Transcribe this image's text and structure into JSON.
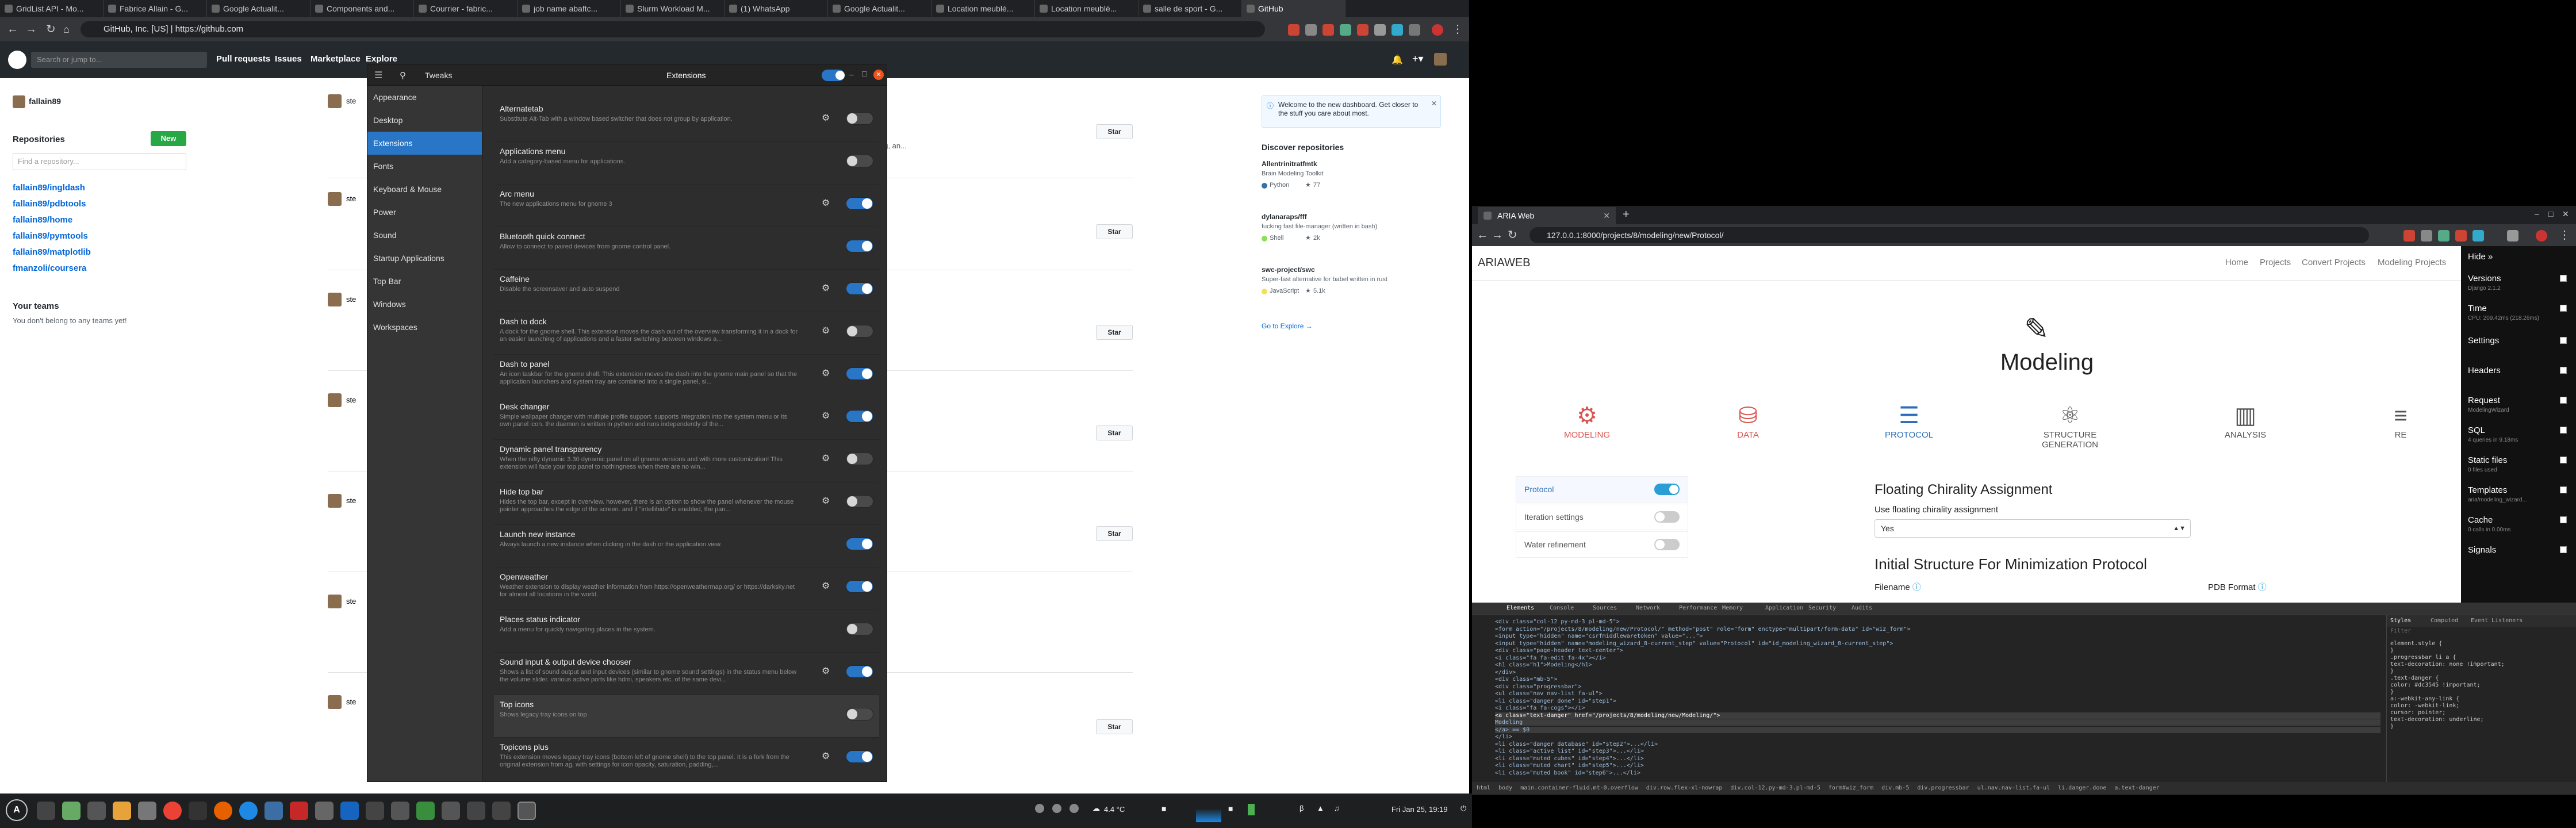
{
  "left_browser": {
    "tabs": [
      "GridList API - Mo...",
      "Fabrice Allain - G...",
      "Google Actualit...",
      "Components and...",
      "Courrier - fabric...",
      "job name abaftc...",
      "Slurm Workload M...",
      "(1) WhatsApp",
      "Google Actualit...",
      "Location meublé...",
      "Location meublé...",
      "salle de sport - G...",
      "GitHub"
    ],
    "url": "GitHub, Inc. [US]  |  https://github.com"
  },
  "github": {
    "search_placeholder": "Search or jump to...",
    "nav": [
      "Pull requests",
      "Issues",
      "Marketplace",
      "Explore"
    ],
    "user": "fallain89",
    "repositories_heading": "Repositories",
    "new_button": "New",
    "find_repo_placeholder": "Find a repository...",
    "repos": [
      "fallain89/ingldash",
      "fallain89/pdbtools",
      "fallain89/home",
      "fallain89/pymtools",
      "fallain89/matplotlib",
      "fmanzoli/coursera"
    ],
    "teams_heading": "Your teams",
    "teams_text": "You don't belong to any teams yet!",
    "feed_star": "Star",
    "feed_snippet": "eg, an...",
    "welcome_text": "Welcome to the new dashboard. Get closer to the stuff you care about most.",
    "discover_heading": "Discover repositories",
    "discover": [
      {
        "name": "Allentrinitratfmtk",
        "desc": "Brain Modeling Toolkit",
        "lang": "Python",
        "stars": "77"
      },
      {
        "name": "dylanaraps/fff",
        "desc": "fucking fast file-manager (written in bash)",
        "lang": "Shell",
        "stars": "2k"
      },
      {
        "name": "swc-project/swc",
        "desc": "Super-fast alternative for babel written in rust",
        "lang": "JavaScript",
        "stars": "5.1k"
      }
    ],
    "go_explore": "Go to Explore →"
  },
  "tweaks": {
    "app_name": "Tweaks",
    "section_title": "Extensions",
    "nav": [
      "Appearance",
      "Desktop",
      "Extensions",
      "Fonts",
      "Keyboard & Mouse",
      "Power",
      "Sound",
      "Startup Applications",
      "Top Bar",
      "Windows",
      "Workspaces"
    ],
    "extensions": [
      {
        "name": "Alternatetab",
        "desc": "Substitute Alt-Tab with a window based switcher that does not group by application.",
        "gear": true,
        "on": false
      },
      {
        "name": "Applications menu",
        "desc": "Add a category-based menu for applications.",
        "gear": false,
        "on": false
      },
      {
        "name": "Arc menu",
        "desc": "The new applications menu for gnome 3",
        "gear": true,
        "on": true
      },
      {
        "name": "Bluetooth quick connect",
        "desc": "Allow to connect to paired devices from gnome control panel.",
        "gear": false,
        "on": true
      },
      {
        "name": "Caffeine",
        "desc": "Disable the screensaver and auto suspend",
        "gear": true,
        "on": true
      },
      {
        "name": "Dash to dock",
        "desc": "A dock for the gnome shell. This extension moves the dash out of the overview transforming it in a dock for an easier launching of applications and a faster switching between windows a...",
        "gear": true,
        "on": false
      },
      {
        "name": "Dash to panel",
        "desc": "An icon taskbar for the gnome shell. This extension moves the dash into the gnome main panel so that the application launchers and system tray are combined into a single panel, si...",
        "gear": true,
        "on": true
      },
      {
        "name": "Desk changer",
        "desc": "Simple wallpaper changer with multiple profile support. supports integration into the system menu or its own panel icon. the daemon is written in python and runs independently of the...",
        "gear": true,
        "on": true
      },
      {
        "name": "Dynamic panel transparency",
        "desc": "When the nifty dynamic 3.30 dynamic panel on all gnome versions and with more customization! This extension will fade your top panel to nothingness when there are no win...",
        "gear": true,
        "on": false
      },
      {
        "name": "Hide top bar",
        "desc": "Hides the top bar, except in overview. however, there is an option to show the panel whenever the mouse pointer approaches the edge of the screen. and if \"intellihide\" is enabled, the pan...",
        "gear": true,
        "on": false
      },
      {
        "name": "Launch new instance",
        "desc": "Always launch a new instance when clicking in the dash or the application view.",
        "gear": false,
        "on": true
      },
      {
        "name": "Openweather",
        "desc": "Weather extension to display weather information from https://openweathermap.org/ or https://darksky.net for almost all locations in the world.",
        "gear": true,
        "on": true
      },
      {
        "name": "Places status indicator",
        "desc": "Add a menu for quickly navigating places in the system.",
        "gear": false,
        "on": false
      },
      {
        "name": "Sound input & output device chooser",
        "desc": "Shows a list of sound output and input devices (similar to gnome sound settings) in the status menu below the volume slider. various active ports like hdmi, speakers etc. of the same devi...",
        "gear": true,
        "on": true
      },
      {
        "name": "Top icons",
        "desc": "Shows legacy tray icons on top",
        "gear": false,
        "on": false
      },
      {
        "name": "Topicons plus",
        "desc": "This extension moves legacy tray icons (bottom left of gnome shell) to the top panel. It is a fork from the original extension from ag, with settings for icon opacity, saturation, padding,...",
        "gear": true,
        "on": true
      }
    ]
  },
  "right_browser": {
    "tab": "ARIA Web",
    "url": "127.0.0.1:8000/projects/8/modeling/new/Protocol/",
    "brand": "ARIAWEB",
    "nav": [
      "Home",
      "Projects",
      "Convert Projects",
      "Modeling Projects"
    ],
    "page_title": "Modeling",
    "steps": [
      {
        "label": "MODELING",
        "color": "#d9534f"
      },
      {
        "label": "DATA",
        "color": "#d9534f"
      },
      {
        "label": "PROTOCOL",
        "color": "#2a6ebb"
      },
      {
        "label": "STRUCTURE GENERATION",
        "color": "#555555"
      },
      {
        "label": "ANALYSIS",
        "color": "#555555"
      },
      {
        "label": "RE",
        "color": "#555555"
      }
    ],
    "sidebar": [
      {
        "label": "Protocol",
        "on": true
      },
      {
        "label": "Iteration settings",
        "on": false
      },
      {
        "label": "Water refinement",
        "on": false
      }
    ],
    "section1_title": "Floating Chirality Assignment",
    "floating_label": "Use floating chirality assignment",
    "floating_value": "Yes",
    "section2_title": "Initial Structure For Minimization Protocol",
    "filename_label": "Filename",
    "pdb_label": "PDB Format",
    "debug_toolbar": [
      {
        "name": "Hide »",
        "sub": ""
      },
      {
        "name": "Versions",
        "sub": "Django 2.1.2"
      },
      {
        "name": "Time",
        "sub": "CPU: 209.42ms (218.26ms)"
      },
      {
        "name": "Settings",
        "sub": ""
      },
      {
        "name": "Headers",
        "sub": ""
      },
      {
        "name": "Request",
        "sub": "ModelingWizard"
      },
      {
        "name": "SQL",
        "sub": "4 queries in 9.18ms"
      },
      {
        "name": "Static files",
        "sub": "0 files used"
      },
      {
        "name": "Templates",
        "sub": "aria/modeling_wizard..."
      },
      {
        "name": "Cache",
        "sub": "0 calls in 0.00ms"
      },
      {
        "name": "Signals",
        "sub": ""
      }
    ],
    "devtools_tabs": [
      "Elements",
      "Console",
      "Sources",
      "Network",
      "Performance",
      "Memory",
      "Application",
      "Security",
      "Audits"
    ],
    "devtools_styles_tabs": [
      "Styles",
      "Computed",
      "Event Listeners"
    ],
    "filter_placeholder": "Filter",
    "code": [
      "<div class=\"col-12 py-md-3 pl-md-5\">",
      "<form action=\"/projects/8/modeling/new/Protocol/\" method=\"post\" role=\"form\" enctype=\"multipart/form-data\" id=\"wiz_form\">",
      "<input type=\"hidden\" name=\"csrfmiddlewaretoken\" value=\"...\">",
      "<input type=\"hidden\" name=\"modeling_wizard_8-current_step\" value=\"Protocol\" id=\"id_modeling_wizard_8-current_step\">",
      "<div class=\"page-header text-center\">",
      "<i class=\"fa fa-edit fa-4x\"></i>",
      "<h1 class=\"h1\">Modeling</h1>",
      "</div>",
      "<div class=\"mb-5\">",
      "<div class=\"progressbar\">",
      "<ul class=\"nav nav-list fa-ul\">",
      "<li class=\"danger done\" id=\"step1\">",
      "<i class=\"fa fa-cogs\"></i>",
      "<a class=\"text-danger\" href=\"/projects/8/modeling/new/Modeling/\">",
      "Modeling",
      "</a> == $0",
      "</li>",
      "<li class=\"danger database\" id=\"step2\">...</li>",
      "<li class=\"active list\" id=\"step3\">...</li>",
      "<li class=\"muted cubes\" id=\"step4\">...</li>",
      "<li class=\"muted chart\" id=\"step5\">...</li>",
      "<li class=\"muted book\" id=\"step6\">...</li>"
    ],
    "styles": [
      "element.style {",
      "}",
      ".progressbar li a {",
      "text-decoration: none !important;",
      "}",
      ".text-danger {",
      "color: #dc3545 !important;",
      "}",
      "a:-webkit-any-link {",
      "color: -webkit-link;",
      "cursor: pointer;",
      "text-decoration: underline;",
      "}"
    ],
    "breadcrumb": [
      "html",
      "body",
      "main.container-fluid.mt-0.overflow",
      "div.row.flex-xl-nowrap",
      "div.col-12.py-md-3.pl-md-5",
      "form#wiz_form",
      "div.mb-5",
      "div.progressbar",
      "ul.nav.nav-list.fa-ul",
      "li.danger.done",
      "a.text-danger"
    ]
  },
  "taskbar": {
    "weather": "4.4 °C",
    "clock": "Fri Jan 25, 19:19"
  }
}
